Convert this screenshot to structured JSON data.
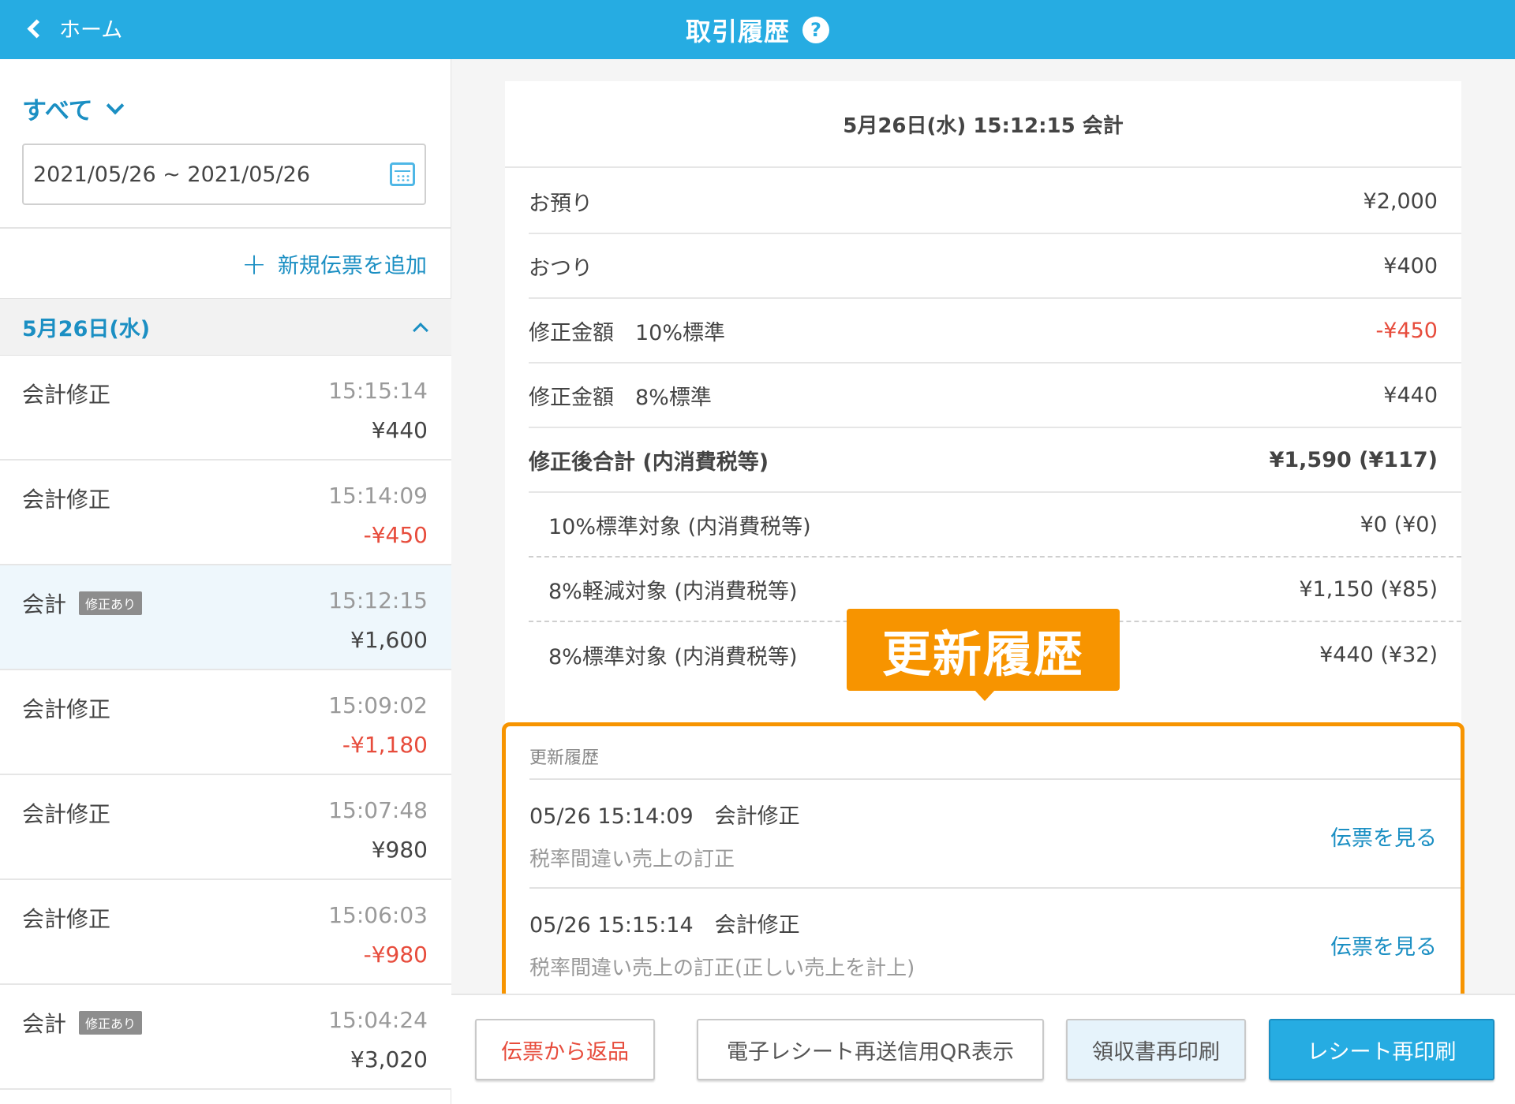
{
  "header": {
    "back_label": "ホーム",
    "title": "取引履歴",
    "help_label": "?"
  },
  "sidebar": {
    "filter_label": "すべて",
    "date_range": "2021/05/26 ~ 2021/05/26",
    "add_ticket_label": "新規伝票を追加",
    "date_group_label": "5月26日(水)",
    "transactions": [
      {
        "name": "会計修正",
        "badge": "",
        "time": "15:15:14",
        "amount": "¥440",
        "negative": false,
        "selected": false
      },
      {
        "name": "会計修正",
        "badge": "",
        "time": "15:14:09",
        "amount": "-¥450",
        "negative": true,
        "selected": false
      },
      {
        "name": "会計",
        "badge": "修正あり",
        "time": "15:12:15",
        "amount": "¥1,600",
        "negative": false,
        "selected": true
      },
      {
        "name": "会計修正",
        "badge": "",
        "time": "15:09:02",
        "amount": "-¥1,180",
        "negative": true,
        "selected": false
      },
      {
        "name": "会計修正",
        "badge": "",
        "time": "15:07:48",
        "amount": "¥980",
        "negative": false,
        "selected": false
      },
      {
        "name": "会計修正",
        "badge": "",
        "time": "15:06:03",
        "amount": "-¥980",
        "negative": true,
        "selected": false
      },
      {
        "name": "会計",
        "badge": "修正あり",
        "time": "15:04:24",
        "amount": "¥3,020",
        "negative": false,
        "selected": false
      }
    ]
  },
  "detail": {
    "heading": "5月26日(水) 15:12:15 会計",
    "rows": [
      {
        "label": "お預り",
        "value": "¥2,000",
        "style": "normal",
        "negative": false
      },
      {
        "label": "おつり",
        "value": "¥400",
        "style": "normal",
        "negative": false
      },
      {
        "label": "修正金額　10%標準",
        "value": "-¥450",
        "style": "normal",
        "negative": true
      },
      {
        "label": "修正金額　8%標準",
        "value": "¥440",
        "style": "normal",
        "negative": false
      },
      {
        "label": "修正後合計 (内消費税等)",
        "value": "¥1,590 (¥117)",
        "style": "bold",
        "negative": false
      },
      {
        "label": "10%標準対象 (内消費税等)",
        "value": "¥0 (¥0)",
        "style": "sub",
        "negative": false
      },
      {
        "label": "8%軽減対象 (内消費税等)",
        "value": "¥1,150 (¥85)",
        "style": "sub",
        "negative": false
      },
      {
        "label": "8%標準対象 (内消費税等)",
        "value": "¥440 (¥32)",
        "style": "last",
        "negative": false
      }
    ],
    "history": {
      "title": "更新履歴",
      "items": [
        {
          "main": "05/26 15:14:09　会計修正",
          "note": "税率間違い売上の訂正",
          "link": "伝票を見る"
        },
        {
          "main": "05/26 15:15:14　会計修正",
          "note": "税率間違い売上の訂正(正しい売上を計上)",
          "link": "伝票を見る"
        }
      ]
    },
    "callout_label": "更新履歴"
  },
  "actions": {
    "return_label": "伝票から返品",
    "qr_label": "電子レシート再送信用QR表示",
    "receipt_label": "領収書再印刷",
    "reprint_label": "レシート再印刷"
  },
  "colors": {
    "header_bg": "#26ace2",
    "accent_text": "#1b8fc3",
    "negative": "#e74c3c",
    "highlight": "#f79400"
  }
}
